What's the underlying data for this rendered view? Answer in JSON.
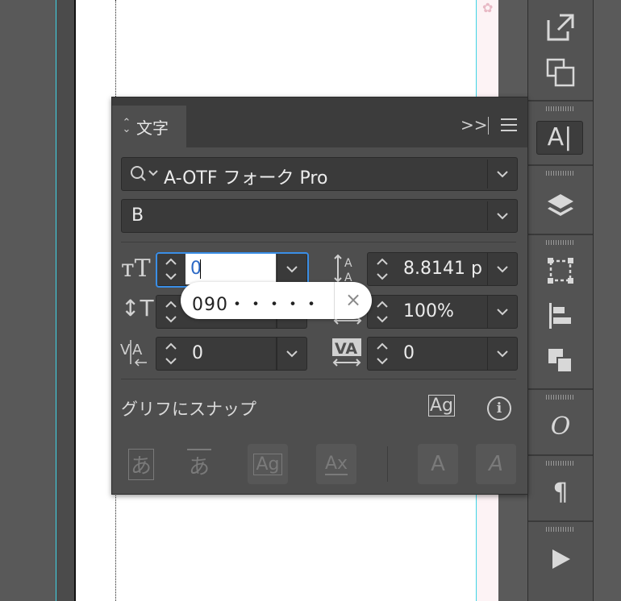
{
  "panel": {
    "tab_title": "文字",
    "collapse_glyph": ">>",
    "font_family": "A-OTF フォーク Pro",
    "font_style": "B",
    "font_size_value": "0",
    "leading_value": "8.8141 p",
    "horizontal_scale_value": "100%",
    "kerning_value": "0",
    "tracking_value": "0",
    "autocomplete_suggestion": "090・・・・・",
    "tooltip_close": "×",
    "snap_label": "グリフにスナップ",
    "info_glyph": "i",
    "glyph_snap_glyph": "Ag",
    "bottom_buttons": [
      "あ",
      "あ",
      "Ag",
      "Ax",
      "A",
      "A"
    ]
  },
  "icons": {
    "dock": [
      "external-link-icon",
      "duplicate-icon",
      "character-icon",
      "layers-icon",
      "transform-icon",
      "align-icon",
      "pathfinder-icon",
      "opentype-icon",
      "paragraph-icon",
      "play-icon"
    ]
  },
  "dock": {
    "character_glyph": "A|",
    "opentype_glyph": "O",
    "paragraph_glyph": "¶"
  },
  "colors": {
    "focus": "#3a8ee6",
    "guide": "#3fd3e6"
  }
}
